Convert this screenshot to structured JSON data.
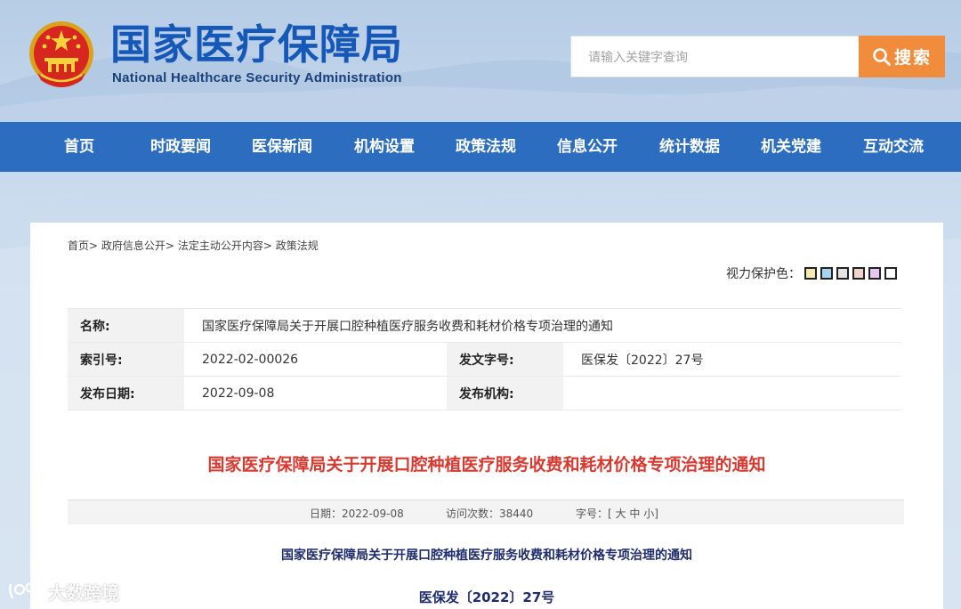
{
  "header": {
    "site_title": "国家医疗保障局",
    "site_subtitle": "National Healthcare Security Administration",
    "search": {
      "placeholder": "请输入关键字查询",
      "button_label": "搜索",
      "button_icon": "search-icon"
    }
  },
  "nav": {
    "items": [
      "首页",
      "时政要闻",
      "医保新闻",
      "机构设置",
      "政策法规",
      "信息公开",
      "统计数据",
      "机关党建",
      "互动交流"
    ]
  },
  "breadcrumb": {
    "items": [
      "首页",
      "政府信息公开",
      "法定主动公开内容",
      "政策法规"
    ],
    "separator": ">"
  },
  "eye_protection": {
    "label": "视力保护色：",
    "swatches": [
      "#f5eab1",
      "#a9d4ef",
      "#e4e4e4",
      "#f0d3cd",
      "#e7c7ef",
      "#ffffff"
    ]
  },
  "meta": {
    "name_label": "名称:",
    "name_value": "国家医疗保障局关于开展口腔种植医疗服务收费和耗材价格专项治理的通知",
    "index_label": "索引号:",
    "index_value": "2022-02-00026",
    "docno_label": "发文字号:",
    "docno_value": "医保发〔2022〕27号",
    "date_label": "发布日期:",
    "date_value": "2022-09-08",
    "org_label": "发布机构:",
    "org_value": ""
  },
  "article": {
    "title": "国家医疗保障局关于开展口腔种植医疗服务收费和耗材价格专项治理的通知",
    "info": {
      "date_label": "日期：",
      "date_value": "2022-09-08",
      "visits_label": "访问次数：",
      "visits_value": "38440",
      "fontsize_label": "字号：",
      "fontsize_open": "[",
      "fontsize_large": "大",
      "fontsize_medium": "中",
      "fontsize_small": "小",
      "fontsize_close": "]"
    },
    "body_title": "国家医疗保障局关于开展口腔种植医疗服务收费和耗材价格专项治理的通知",
    "doc_number": "医保发〔2022〕27号"
  },
  "watermark": {
    "text": "大数跨境"
  },
  "colors": {
    "brand_blue": "#1658b8",
    "nav_blue": "#2c6dbf",
    "search_orange": "#f08c3c",
    "title_red": "#d73a30",
    "body_navy": "#1f2d6e"
  }
}
